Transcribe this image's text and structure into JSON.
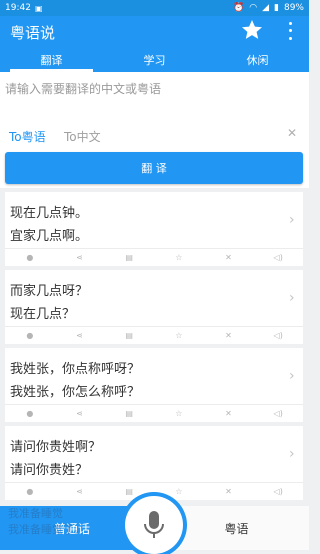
{
  "status_bar": {
    "time": "19:42",
    "battery": "89%"
  },
  "app": {
    "title": "粤语说"
  },
  "tabs": [
    {
      "label": "翻译",
      "active": true
    },
    {
      "label": "学习",
      "active": false
    },
    {
      "label": "休闲",
      "active": false
    }
  ],
  "input": {
    "placeholder": "请输入需要翻译的中文或粤语"
  },
  "lang": {
    "to_cantonese": "To粤语",
    "to_mandarin": "To中文"
  },
  "translate_button": "翻 译",
  "cards": [
    {
      "line1": "现在几点钟。",
      "line2": "宜家几点啊。"
    },
    {
      "line1": "而家几点呀？",
      "line2": "现在几点？"
    },
    {
      "line1": "我姓张，你点称呼呀？",
      "line2": "我姓张，你怎么称呼？"
    },
    {
      "line1": "请问你贵姓啊？",
      "line2": "请问你贵姓？"
    }
  ],
  "peek_card": {
    "line1": "我准备睡觉",
    "line2": "我准备睡觉了。"
  },
  "bottom": {
    "mandarin": "普通话",
    "cantonese": "粤语"
  },
  "colors": {
    "primary": "#2196f3",
    "status": "#1b8fe0"
  },
  "icons": [
    "android-icon",
    "alarm-icon",
    "wifi-icon",
    "signal-icon",
    "battery-icon",
    "star-icon",
    "more-vert-icon",
    "microphone-icon",
    "share-icon",
    "copy-icon",
    "favorite-icon",
    "delete-icon",
    "speaker-icon",
    "chevron-right-icon"
  ]
}
